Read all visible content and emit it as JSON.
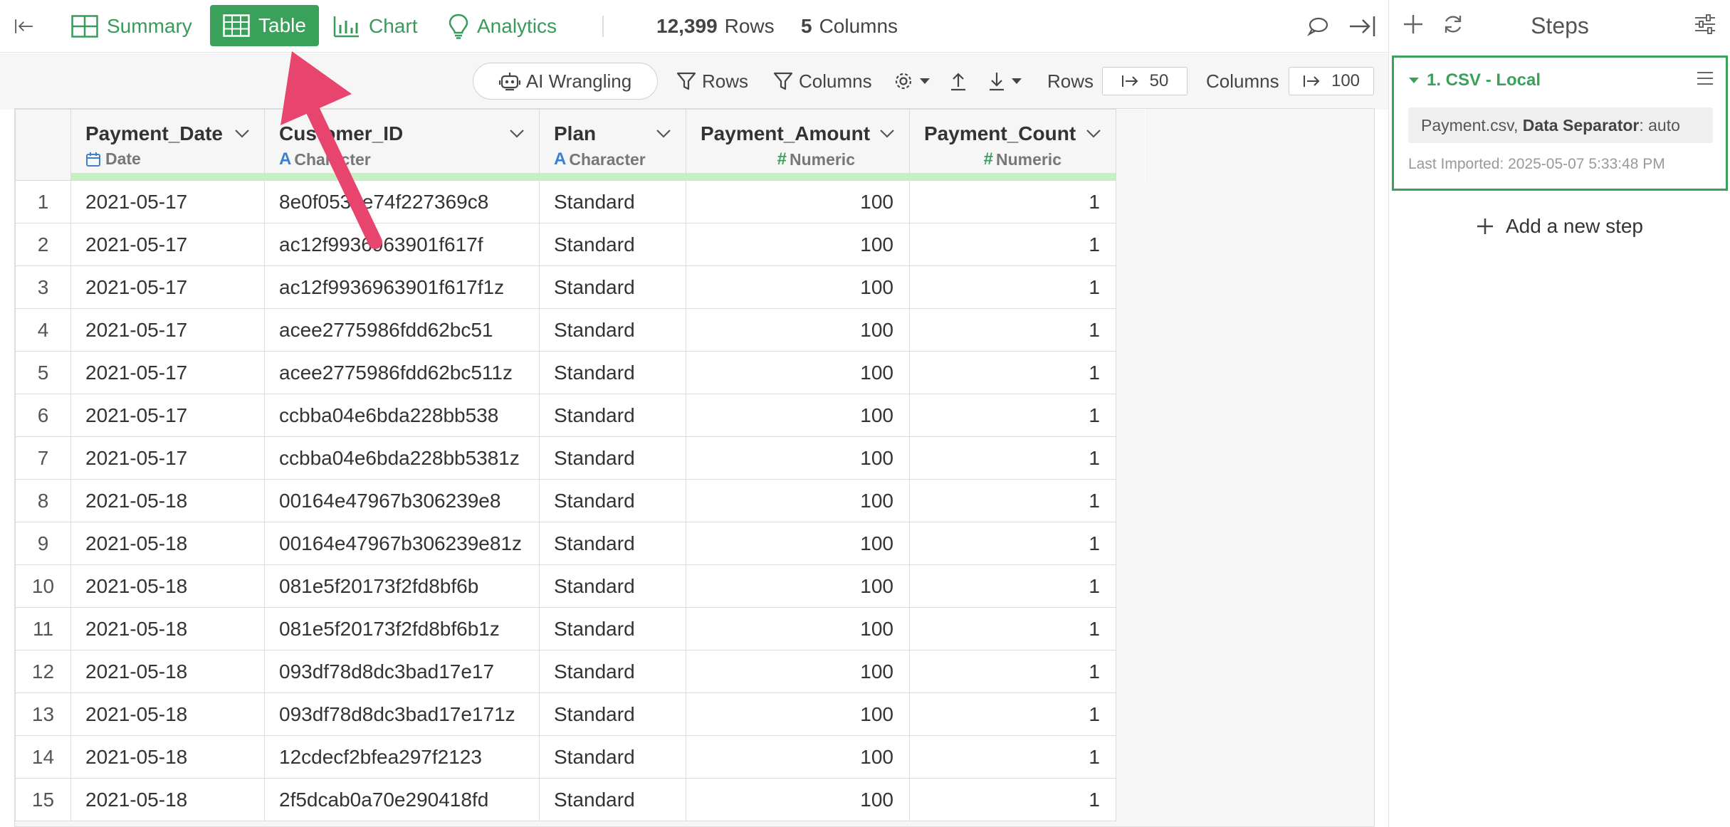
{
  "topbar": {
    "nav": {
      "summary": "Summary",
      "table": "Table",
      "chart": "Chart",
      "analytics": "Analytics"
    },
    "rows_count": "12,399",
    "rows_label": "Rows",
    "cols_count": "5",
    "cols_label": "Columns"
  },
  "toolbar": {
    "ai_wrangling": "AI Wrangling",
    "filter_rows": "Rows",
    "filter_columns": "Columns",
    "rows_label": "Rows",
    "rows_value": "50",
    "columns_label": "Columns",
    "columns_value": "100"
  },
  "table": {
    "columns": [
      {
        "name": "Payment_Date",
        "type": "Date"
      },
      {
        "name": "Customer_ID",
        "type": "Character"
      },
      {
        "name": "Plan",
        "type": "Character"
      },
      {
        "name": "Payment_Amount",
        "type": "Numeric"
      },
      {
        "name": "Payment_Count",
        "type": "Numeric"
      }
    ],
    "rows": [
      [
        "1",
        "2021-05-17",
        "8e0f053be74f227369c8",
        "Standard",
        "100",
        "1"
      ],
      [
        "2",
        "2021-05-17",
        "ac12f9936963901f617f",
        "Standard",
        "100",
        "1"
      ],
      [
        "3",
        "2021-05-17",
        "ac12f9936963901f617f1z",
        "Standard",
        "100",
        "1"
      ],
      [
        "4",
        "2021-05-17",
        "acee2775986fdd62bc51",
        "Standard",
        "100",
        "1"
      ],
      [
        "5",
        "2021-05-17",
        "acee2775986fdd62bc511z",
        "Standard",
        "100",
        "1"
      ],
      [
        "6",
        "2021-05-17",
        "ccbba04e6bda228bb538",
        "Standard",
        "100",
        "1"
      ],
      [
        "7",
        "2021-05-17",
        "ccbba04e6bda228bb5381z",
        "Standard",
        "100",
        "1"
      ],
      [
        "8",
        "2021-05-18",
        "00164e47967b306239e8",
        "Standard",
        "100",
        "1"
      ],
      [
        "9",
        "2021-05-18",
        "00164e47967b306239e81z",
        "Standard",
        "100",
        "1"
      ],
      [
        "10",
        "2021-05-18",
        "081e5f20173f2fd8bf6b",
        "Standard",
        "100",
        "1"
      ],
      [
        "11",
        "2021-05-18",
        "081e5f20173f2fd8bf6b1z",
        "Standard",
        "100",
        "1"
      ],
      [
        "12",
        "2021-05-18",
        "093df78d8dc3bad17e17",
        "Standard",
        "100",
        "1"
      ],
      [
        "13",
        "2021-05-18",
        "093df78d8dc3bad17e171z",
        "Standard",
        "100",
        "1"
      ],
      [
        "14",
        "2021-05-18",
        "12cdecf2bfea297f2123",
        "Standard",
        "100",
        "1"
      ],
      [
        "15",
        "2021-05-18",
        "2f5dcab0a70e290418fd",
        "Standard",
        "100",
        "1"
      ]
    ]
  },
  "steps": {
    "title": "Steps",
    "step1": {
      "name": "1. CSV - Local",
      "file": "Payment.csv, ",
      "sep_label": "Data Separator",
      "sep_value": ": auto",
      "imported": "Last Imported: 2025-05-07 5:33:48 PM"
    },
    "add_step": "Add a new step"
  },
  "colors": {
    "accent": "#3aa15b",
    "annotation_arrow": "#e8456e",
    "quality_bar": "#c6efc3"
  }
}
